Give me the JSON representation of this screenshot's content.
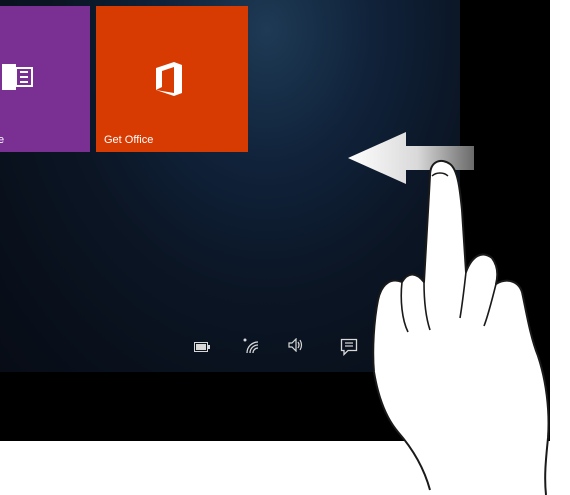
{
  "tiles": {
    "onenote": {
      "label": "e",
      "icon": "onenote-icon",
      "color": "#7a2f93"
    },
    "office": {
      "label": "Get Office",
      "icon": "office-icon",
      "color": "#d83b01"
    }
  },
  "tray": {
    "icons": [
      "battery-icon",
      "network-icon",
      "volume-icon",
      "action-center-icon"
    ]
  },
  "gesture": {
    "type": "swipe-left-from-right-edge",
    "icons": [
      "arrow-left-icon",
      "hand-icon"
    ]
  }
}
